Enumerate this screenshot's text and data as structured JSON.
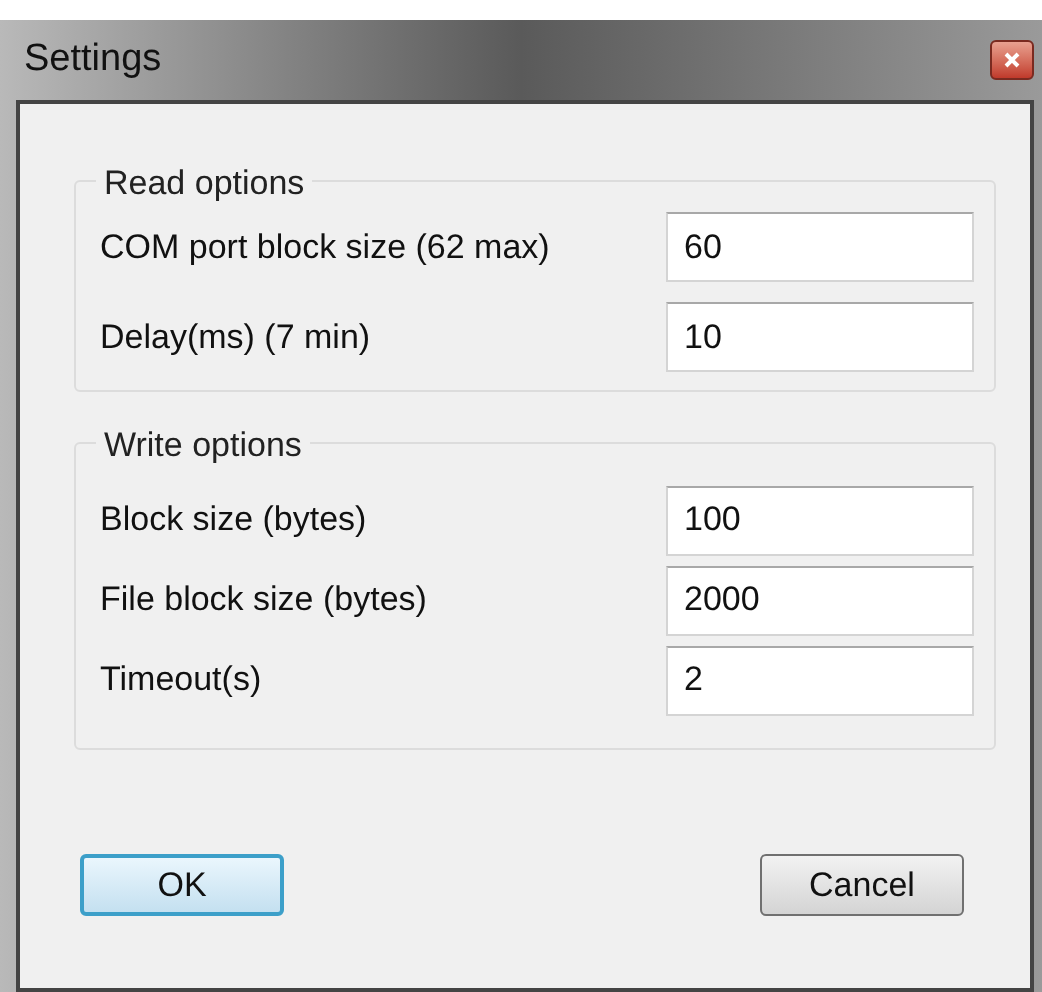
{
  "window": {
    "title": "Settings"
  },
  "groups": [
    {
      "title": "Read options",
      "fields": [
        {
          "label": "COM port block size (62 max)",
          "value": "60"
        },
        {
          "label": "Delay(ms) (7 min)",
          "value": "10"
        }
      ]
    },
    {
      "title": "Write options",
      "fields": [
        {
          "label": "Block size (bytes)",
          "value": "100"
        },
        {
          "label": "File block size (bytes)",
          "value": "2000"
        },
        {
          "label": "Timeout(s)",
          "value": "2"
        }
      ]
    }
  ],
  "buttons": [
    {
      "label": "OK",
      "default": true
    },
    {
      "label": "Cancel",
      "default": false
    }
  ]
}
